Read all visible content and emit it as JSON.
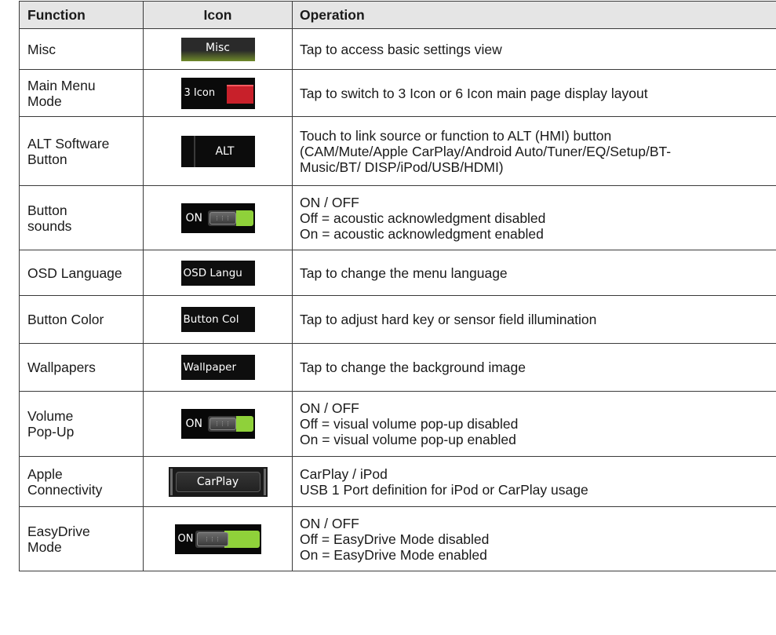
{
  "header": {
    "function": "Function",
    "icon": "Icon",
    "operation": "Operation"
  },
  "rows": [
    {
      "function": [
        "Misc"
      ],
      "icon_text": "Misc",
      "icon_name": "misc-icon",
      "operation": [
        "Tap to access basic settings view"
      ]
    },
    {
      "function": [
        "Main Menu",
        "Mode"
      ],
      "icon_text": "3 Icon",
      "icon_name": "main-menu-mode-icon",
      "operation": [
        "Tap to switch to 3 Icon or 6 Icon main page display layout"
      ]
    },
    {
      "function": [
        "ALT Software",
        "Button"
      ],
      "icon_text": "ALT",
      "icon_name": "alt-button-icon",
      "operation": [
        "Touch to link source or function to ALT (HMI) button",
        "(CAM/Mute/Apple CarPlay/Android Auto/Tuner/EQ/Setup/BT-",
        "Music/BT/ DISP/iPod/USB/HDMI)"
      ]
    },
    {
      "function": [
        "Button",
        "sounds"
      ],
      "icon_text": "ON",
      "icon_name": "toggle-switch-icon",
      "operation": [
        "ON / OFF",
        "Off = acoustic acknowledgment disabled",
        "On = acoustic acknowledgment enabled"
      ]
    },
    {
      "function": [
        "OSD Language"
      ],
      "icon_text": "OSD Langu",
      "icon_name": "osd-language-icon",
      "operation": [
        "Tap to change the menu language"
      ]
    },
    {
      "function": [
        "Button Color"
      ],
      "icon_text": "Button Col",
      "icon_name": "button-color-icon",
      "operation": [
        "Tap to adjust hard key or sensor field illumination"
      ]
    },
    {
      "function": [
        "Wallpapers"
      ],
      "icon_text": "Wallpaper",
      "icon_name": "wallpapers-icon",
      "operation": [
        "Tap to change the background image"
      ]
    },
    {
      "function": [
        "Volume",
        "Pop-Up"
      ],
      "icon_text": "ON",
      "icon_name": "toggle-switch-icon",
      "operation": [
        "ON / OFF",
        "Off = visual volume pop-up disabled",
        "On = visual volume pop-up enabled"
      ]
    },
    {
      "function": [
        "Apple",
        "Connectivity"
      ],
      "icon_text": "CarPlay",
      "icon_name": "carplay-icon",
      "operation": [
        "CarPlay / iPod",
        "USB 1 Port definition for iPod or CarPlay usage"
      ]
    },
    {
      "function": [
        "EasyDrive",
        "Mode"
      ],
      "icon_text": "ON",
      "icon_name": "easydrive-toggle-icon",
      "operation": [
        "ON / OFF",
        "Off = EasyDrive Mode disabled",
        "On = EasyDrive Mode enabled"
      ]
    }
  ]
}
